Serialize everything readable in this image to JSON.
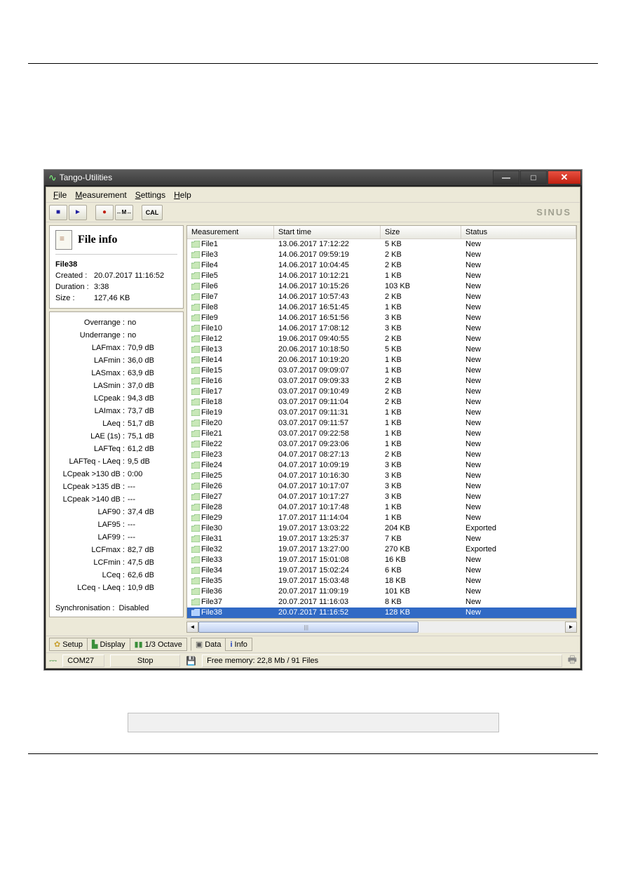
{
  "window": {
    "title": "Tango-Utilities"
  },
  "menu": {
    "file": "File",
    "measurement": "Measurement",
    "settings": "Settings",
    "help": "Help"
  },
  "toolbar": {
    "stop": "■",
    "play": "►",
    "record": "●",
    "m": "M",
    "cal": "CAL"
  },
  "brand": "SINUS",
  "fileinfo": {
    "title": "File info",
    "name": "File38",
    "created_lbl": "Created :",
    "created": "20.07.2017 11:16:52",
    "duration_lbl": "Duration :",
    "duration": "3:38",
    "size_lbl": "Size :",
    "size": "127,46 KB"
  },
  "metrics": [
    {
      "lbl": "Overrange :",
      "val": "no"
    },
    {
      "lbl": "Underrange :",
      "val": "no"
    },
    {
      "lbl": "LAFmax :",
      "val": "70,9 dB"
    },
    {
      "lbl": "LAFmin :",
      "val": "36,0 dB"
    },
    {
      "lbl": "LASmax :",
      "val": "63,9 dB"
    },
    {
      "lbl": "LASmin :",
      "val": "37,0 dB"
    },
    {
      "lbl": "LCpeak :",
      "val": "94,3 dB"
    },
    {
      "lbl": "LAImax :",
      "val": "73,7 dB"
    },
    {
      "lbl": "LAeq :",
      "val": "51,7 dB"
    },
    {
      "lbl": "LAE (1s) :",
      "val": "75,1 dB"
    },
    {
      "lbl": "LAFTeq :",
      "val": "61,2 dB"
    },
    {
      "lbl": "LAFTeq - LAeq :",
      "val": "9,5 dB"
    },
    {
      "lbl": "LCpeak >130 dB :",
      "val": "0:00"
    },
    {
      "lbl": "LCpeak >135 dB :",
      "val": "---"
    },
    {
      "lbl": "LCpeak >140 dB :",
      "val": "---"
    },
    {
      "lbl": "LAF90 :",
      "val": "37,4 dB"
    },
    {
      "lbl": "LAF95 :",
      "val": "---"
    },
    {
      "lbl": "LAF99 :",
      "val": "---"
    },
    {
      "lbl": "LCFmax :",
      "val": "82,7 dB"
    },
    {
      "lbl": "LCFmin :",
      "val": "47,5 dB"
    },
    {
      "lbl": "LCeq :",
      "val": "62,6 dB"
    },
    {
      "lbl": "LCeq - LAeq :",
      "val": "10,9 dB"
    }
  ],
  "sync": {
    "lbl": "Synchronisation :",
    "val": "Disabled"
  },
  "columns": {
    "measurement": "Measurement",
    "starttime": "Start time",
    "size": "Size",
    "status": "Status"
  },
  "rows": [
    {
      "m": "File1",
      "t": "13.06.2017 17:12:22",
      "s": "5 KB",
      "st": "New",
      "sel": false
    },
    {
      "m": "File3",
      "t": "14.06.2017 09:59:19",
      "s": "2 KB",
      "st": "New",
      "sel": false
    },
    {
      "m": "File4",
      "t": "14.06.2017 10:04:45",
      "s": "2 KB",
      "st": "New",
      "sel": false
    },
    {
      "m": "File5",
      "t": "14.06.2017 10:12:21",
      "s": "1 KB",
      "st": "New",
      "sel": false
    },
    {
      "m": "File6",
      "t": "14.06.2017 10:15:26",
      "s": "103 KB",
      "st": "New",
      "sel": false
    },
    {
      "m": "File7",
      "t": "14.06.2017 10:57:43",
      "s": "2 KB",
      "st": "New",
      "sel": false
    },
    {
      "m": "File8",
      "t": "14.06.2017 16:51:45",
      "s": "1 KB",
      "st": "New",
      "sel": false
    },
    {
      "m": "File9",
      "t": "14.06.2017 16:51:56",
      "s": "3 KB",
      "st": "New",
      "sel": false
    },
    {
      "m": "File10",
      "t": "14.06.2017 17:08:12",
      "s": "3 KB",
      "st": "New",
      "sel": false
    },
    {
      "m": "File12",
      "t": "19.06.2017 09:40:55",
      "s": "2 KB",
      "st": "New",
      "sel": false
    },
    {
      "m": "File13",
      "t": "20.06.2017 10:18:50",
      "s": "5 KB",
      "st": "New",
      "sel": false
    },
    {
      "m": "File14",
      "t": "20.06.2017 10:19:20",
      "s": "1 KB",
      "st": "New",
      "sel": false
    },
    {
      "m": "File15",
      "t": "03.07.2017 09:09:07",
      "s": "1 KB",
      "st": "New",
      "sel": false
    },
    {
      "m": "File16",
      "t": "03.07.2017 09:09:33",
      "s": "2 KB",
      "st": "New",
      "sel": false
    },
    {
      "m": "File17",
      "t": "03.07.2017 09:10:49",
      "s": "2 KB",
      "st": "New",
      "sel": false
    },
    {
      "m": "File18",
      "t": "03.07.2017 09:11:04",
      "s": "2 KB",
      "st": "New",
      "sel": false
    },
    {
      "m": "File19",
      "t": "03.07.2017 09:11:31",
      "s": "1 KB",
      "st": "New",
      "sel": false
    },
    {
      "m": "File20",
      "t": "03.07.2017 09:11:57",
      "s": "1 KB",
      "st": "New",
      "sel": false
    },
    {
      "m": "File21",
      "t": "03.07.2017 09:22:58",
      "s": "1 KB",
      "st": "New",
      "sel": false
    },
    {
      "m": "File22",
      "t": "03.07.2017 09:23:06",
      "s": "1 KB",
      "st": "New",
      "sel": false
    },
    {
      "m": "File23",
      "t": "04.07.2017 08:27:13",
      "s": "2 KB",
      "st": "New",
      "sel": false
    },
    {
      "m": "File24",
      "t": "04.07.2017 10:09:19",
      "s": "3 KB",
      "st": "New",
      "sel": false
    },
    {
      "m": "File25",
      "t": "04.07.2017 10:16:30",
      "s": "3 KB",
      "st": "New",
      "sel": false
    },
    {
      "m": "File26",
      "t": "04.07.2017 10:17:07",
      "s": "3 KB",
      "st": "New",
      "sel": false
    },
    {
      "m": "File27",
      "t": "04.07.2017 10:17:27",
      "s": "3 KB",
      "st": "New",
      "sel": false
    },
    {
      "m": "File28",
      "t": "04.07.2017 10:17:48",
      "s": "1 KB",
      "st": "New",
      "sel": false
    },
    {
      "m": "File29",
      "t": "17.07.2017 11:14:04",
      "s": "1 KB",
      "st": "New",
      "sel": false
    },
    {
      "m": "File30",
      "t": "19.07.2017 13:03:22",
      "s": "204 KB",
      "st": "Exported",
      "sel": false
    },
    {
      "m": "File31",
      "t": "19.07.2017 13:25:37",
      "s": "7 KB",
      "st": "New",
      "sel": false
    },
    {
      "m": "File32",
      "t": "19.07.2017 13:27:00",
      "s": "270 KB",
      "st": "Exported",
      "sel": false
    },
    {
      "m": "File33",
      "t": "19.07.2017 15:01:08",
      "s": "16 KB",
      "st": "New",
      "sel": false
    },
    {
      "m": "File34",
      "t": "19.07.2017 15:02:24",
      "s": "6 KB",
      "st": "New",
      "sel": false
    },
    {
      "m": "File35",
      "t": "19.07.2017 15:03:48",
      "s": "18 KB",
      "st": "New",
      "sel": false
    },
    {
      "m": "File36",
      "t": "20.07.2017 11:09:19",
      "s": "101 KB",
      "st": "New",
      "sel": false
    },
    {
      "m": "File37",
      "t": "20.07.2017 11:16:03",
      "s": "8 KB",
      "st": "New",
      "sel": false
    },
    {
      "m": "File38",
      "t": "20.07.2017 11:16:52",
      "s": "128 KB",
      "st": "New",
      "sel": true
    }
  ],
  "tabs": {
    "setup": "Setup",
    "display": "Display",
    "octave": "1/3 Octave",
    "data": "Data",
    "info": "Info"
  },
  "status": {
    "port": "COM27",
    "state": "Stop",
    "mem": "Free memory: 22,8 Mb  /  91 Files"
  }
}
